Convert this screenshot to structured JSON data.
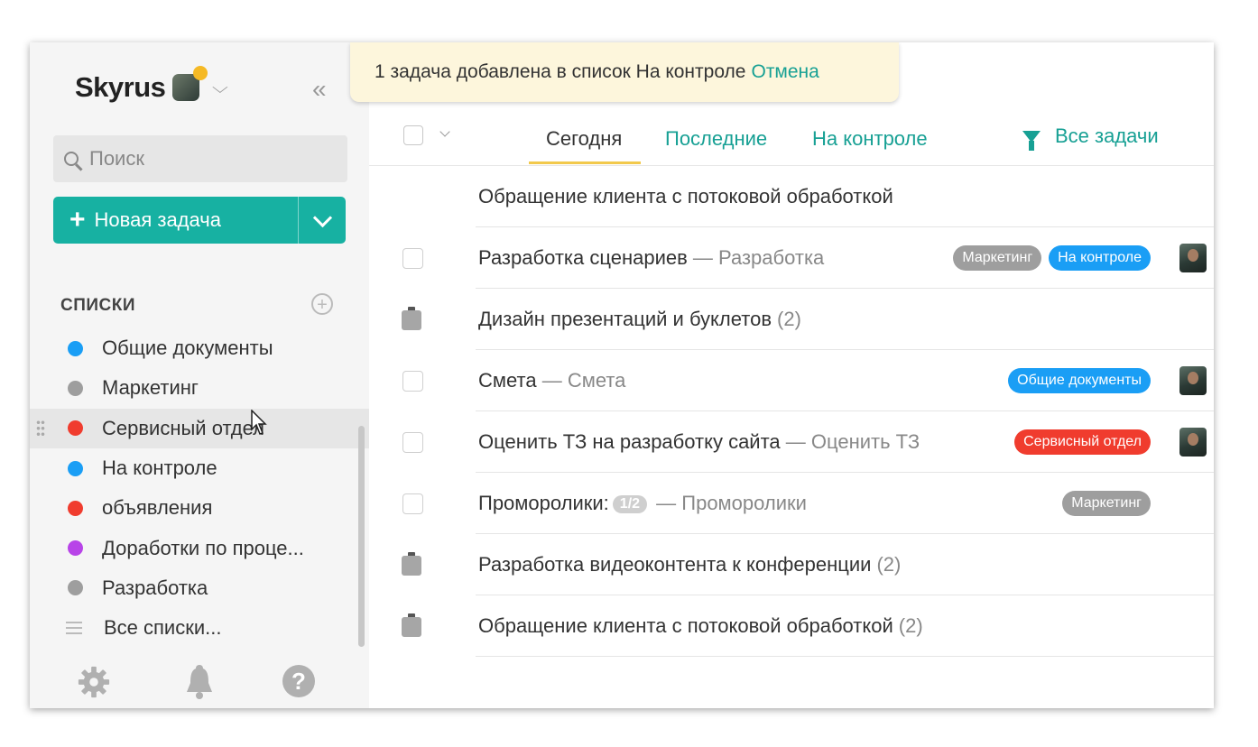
{
  "brand": {
    "name": "Skyrus"
  },
  "search": {
    "placeholder": "Поиск"
  },
  "new_task": {
    "label": "Новая задача"
  },
  "lists": {
    "header": "СПИСКИ",
    "items": [
      {
        "label": "Общие документы",
        "color": "#1a9ef5"
      },
      {
        "label": "Маркетинг",
        "color": "#9e9e9e"
      },
      {
        "label": "Сервисный отдел",
        "color": "#f03c2e"
      },
      {
        "label": "На контроле",
        "color": "#1a9ef5"
      },
      {
        "label": "объявления",
        "color": "#f03c2e"
      },
      {
        "label": "Доработки по проце...",
        "color": "#b844e8"
      },
      {
        "label": "Разработка",
        "color": "#9e9e9e"
      }
    ],
    "all_label": "Все списки..."
  },
  "toast": {
    "text": "1 задача добавлена в список На контроле",
    "undo": "Отмена"
  },
  "tabs": [
    {
      "label": "Сегодня",
      "active": true
    },
    {
      "label": "Последние",
      "active": false
    },
    {
      "label": "На контроле",
      "active": false
    }
  ],
  "filter": {
    "label": "Все задачи"
  },
  "tasks": [
    {
      "title": "Обращение клиента с потоковой обработкой",
      "icon": "none"
    },
    {
      "title": "Разработка сценариев",
      "sub": " — Разработка",
      "icon": "checkbox",
      "tags": [
        {
          "label": "Маркетинг",
          "color": "#9e9e9e"
        },
        {
          "label": "На контроле",
          "color": "#1a9ef5"
        }
      ],
      "avatar": true
    },
    {
      "title": "Дизайн презентаций и буклетов",
      "count": "(2)",
      "icon": "clipboard"
    },
    {
      "title": "Смета",
      "sub": " — Смета",
      "icon": "checkbox",
      "tags": [
        {
          "label": "Общие документы",
          "color": "#1a9ef5"
        }
      ],
      "avatar": true
    },
    {
      "title": "Оценить ТЗ на разработку сайта",
      "sub": " — Оценить ТЗ",
      "icon": "checkbox",
      "tags": [
        {
          "label": "Сервисный отдел",
          "color": "#f03c2e"
        }
      ],
      "avatar": true
    },
    {
      "title": "Проморолики:",
      "progress": "1/2",
      "sub": " — Проморолики",
      "icon": "checkbox",
      "tags": [
        {
          "label": "Маркетинг",
          "color": "#9e9e9e"
        }
      ],
      "avatar": false
    },
    {
      "title": "Разработка видеоконтента к конференции",
      "count": "(2)",
      "icon": "clipboard"
    },
    {
      "title": "Обращение клиента с потоковой обработкой",
      "count": "(2)",
      "icon": "clipboard"
    }
  ]
}
